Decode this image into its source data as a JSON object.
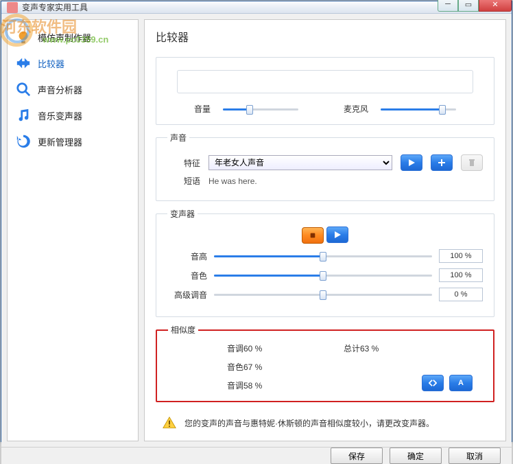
{
  "window": {
    "title": "变声专家实用工具"
  },
  "watermark": {
    "text": "河东软件园",
    "url": "www.pc0359.cn"
  },
  "sidebar": {
    "items": [
      {
        "label": "模仿声制作器",
        "icon": "mimic"
      },
      {
        "label": "比较器",
        "icon": "compare"
      },
      {
        "label": "声音分析器",
        "icon": "analyze"
      },
      {
        "label": "音乐变声器",
        "icon": "music"
      },
      {
        "label": "更新管理器",
        "icon": "update"
      }
    ],
    "active": 1
  },
  "main": {
    "title": "比较器",
    "volume": {
      "label": "音量",
      "value": 35
    },
    "mic": {
      "label": "麦克风",
      "value": 82
    }
  },
  "voice": {
    "legend": "声音",
    "feature_label": "特征",
    "feature_value": "年老女人声音",
    "short_label": "短语",
    "short_text": "He was here."
  },
  "changer": {
    "legend": "变声器",
    "pitch": {
      "label": "音高",
      "value": 50,
      "display": "100 %"
    },
    "timbre": {
      "label": "音色",
      "value": 50,
      "display": "100 %"
    },
    "advanced": {
      "label": "高级调音",
      "value": 50,
      "display": "0 %"
    }
  },
  "similarity": {
    "legend": "相似度",
    "tone": {
      "label": "音调",
      "value": "60 %"
    },
    "total": {
      "label": "总计",
      "value": "63 %"
    },
    "timbre": {
      "label": "音色",
      "value": "67 %"
    },
    "tone2": {
      "label": "音调",
      "value": "58 %"
    }
  },
  "warning": "您的变声的声音与惠特妮·休斯顿的声音相似度较小，请更改变声器。",
  "footer": {
    "save": "保存",
    "ok": "确定",
    "cancel": "取消"
  }
}
